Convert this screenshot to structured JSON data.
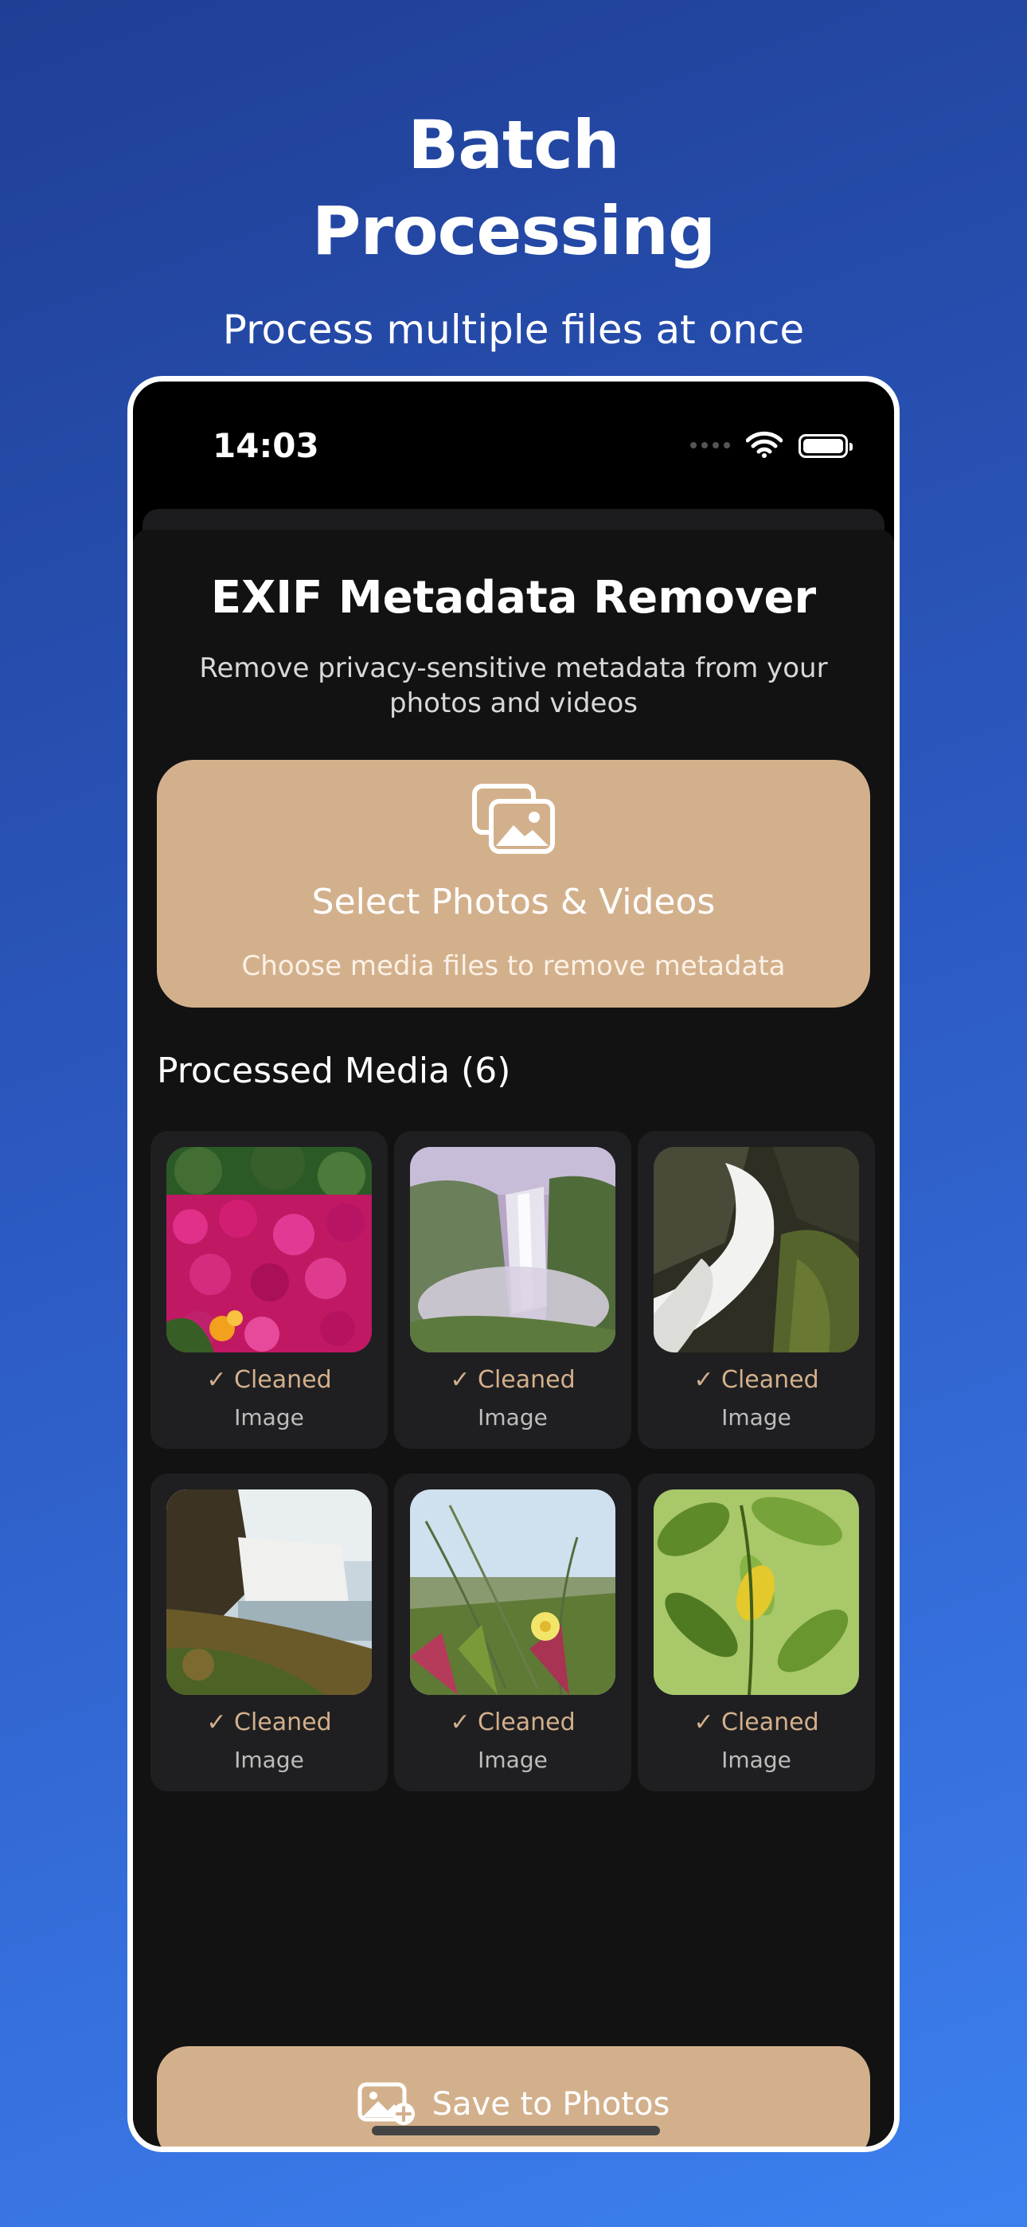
{
  "promo": {
    "title_line1": "Batch",
    "title_line2": "Processing",
    "subtitle": "Process multiple files at once"
  },
  "status_bar": {
    "time": "14:03",
    "icons": [
      "cellular-dots-icon",
      "wifi-icon",
      "battery-icon"
    ]
  },
  "app": {
    "title": "EXIF Metadata Remover",
    "description": "Remove privacy-sensitive metadata from your photos and videos",
    "select_button": {
      "icon": "photo-stack-icon",
      "label": "Select Photos & Videos",
      "sublabel": "Choose media files to remove metadata"
    },
    "processed_title": "Processed Media (6)",
    "media": [
      {
        "thumbnail": "pink-flowers",
        "status": "✓ Cleaned",
        "type": "Image"
      },
      {
        "thumbnail": "misty-waterfall",
        "status": "✓ Cleaned",
        "type": "Image"
      },
      {
        "thumbnail": "long-exposure-stream",
        "status": "✓ Cleaned",
        "type": "Image"
      },
      {
        "thumbnail": "waterfall-cliff",
        "status": "✓ Cleaned",
        "type": "Image"
      },
      {
        "thumbnail": "yellow-flower-grass",
        "status": "✓ Cleaned",
        "type": "Image"
      },
      {
        "thumbnail": "green-leaves",
        "status": "✓ Cleaned",
        "type": "Image"
      }
    ],
    "save_button": {
      "icon": "photo-add-icon",
      "label": "Save to Photos"
    }
  },
  "colors": {
    "background_start": "#1f3f95",
    "background_end": "#3c80ef",
    "accent": "#d3b08c",
    "sheet": "#121212",
    "card": "#1f1f21"
  }
}
